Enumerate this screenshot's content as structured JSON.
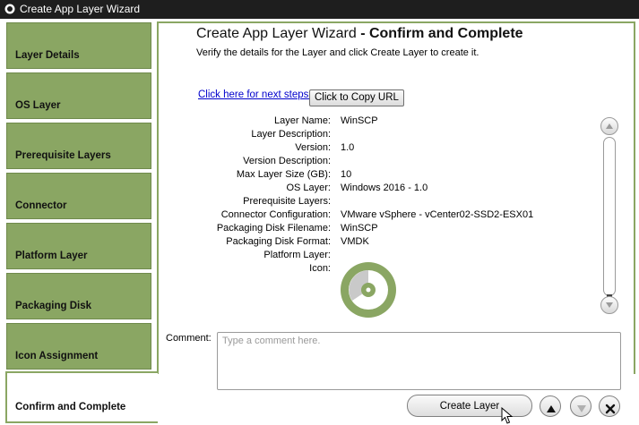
{
  "window": {
    "title": "Create App Layer Wizard"
  },
  "sidebar": {
    "steps": [
      {
        "label": "Layer Details"
      },
      {
        "label": "OS Layer"
      },
      {
        "label": "Prerequisite Layers"
      },
      {
        "label": "Connector"
      },
      {
        "label": "Platform Layer"
      },
      {
        "label": "Packaging Disk"
      },
      {
        "label": "Icon Assignment"
      },
      {
        "label": "Confirm and Complete"
      }
    ],
    "active_index": 7
  },
  "main": {
    "heading_prefix": "Create App Layer Wizard",
    "heading_bold": "- Confirm and Complete",
    "subheading": "Verify the details for the Layer and click Create Layer to create it.",
    "next_steps_link": "Click here for next steps.",
    "copy_url_label": "Click to Copy URL",
    "details": [
      {
        "label": "Layer Name:",
        "value": "WinSCP"
      },
      {
        "label": "Layer Description:",
        "value": ""
      },
      {
        "label": "Version:",
        "value": "1.0"
      },
      {
        "label": "Version Description:",
        "value": ""
      },
      {
        "label": "Max Layer Size (GB):",
        "value": "10"
      },
      {
        "label": "OS Layer:",
        "value": "Windows 2016 - 1.0"
      },
      {
        "label": "Prerequisite Layers:",
        "value": ""
      },
      {
        "label": "Connector Configuration:",
        "value": "VMware vSphere - vCenter02-SSD2-ESX01"
      },
      {
        "label": "Packaging Disk Filename:",
        "value": "WinSCP"
      },
      {
        "label": "Packaging Disk Format:",
        "value": "VMDK"
      },
      {
        "label": "Platform Layer:",
        "value": ""
      },
      {
        "label": "Icon:",
        "value": ""
      }
    ],
    "icon": "disc-layer-icon",
    "comment_label": "Comment:",
    "comment_placeholder": "Type a comment here.",
    "comment_value": ""
  },
  "footer": {
    "create_label": "Create Layer",
    "up_icon": "arrow-up-icon",
    "down_icon": "arrow-down-icon",
    "close_icon": "close-icon"
  },
  "colors": {
    "accent": "#8aa663",
    "titlebar": "#1e1e1e",
    "link": "#0000cc"
  }
}
